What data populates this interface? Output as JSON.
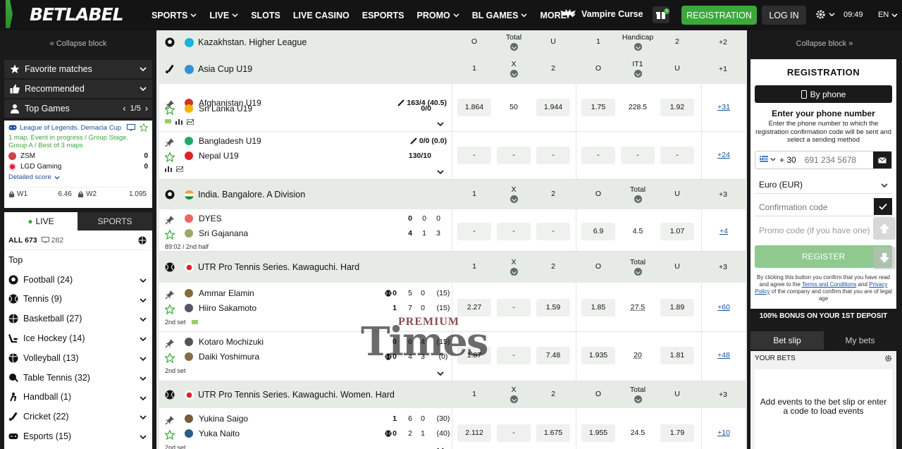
{
  "brand": {
    "logo_text": "BETLABEL"
  },
  "nav": {
    "items": [
      {
        "label": "SPORTS",
        "dropdown": true
      },
      {
        "label": "LIVE",
        "dropdown": true
      },
      {
        "label": "SLOTS",
        "dropdown": false
      },
      {
        "label": "LIVE CASINO",
        "dropdown": false
      },
      {
        "label": "ESPORTS",
        "dropdown": false
      },
      {
        "label": "PROMO",
        "dropdown": true
      },
      {
        "label": "BL GAMES",
        "dropdown": true
      },
      {
        "label": "MORE",
        "dropdown": true
      }
    ],
    "promo_label": "Vampire Curse",
    "gift_badge": "1",
    "register_label": "REGISTRATION",
    "login_label": "LOG IN",
    "time": "09:49",
    "lang": "EN"
  },
  "left": {
    "collapse_label": "Collapse block",
    "favorite_label": "Favorite matches",
    "recommended_label": "Recommended",
    "topgames_label": "Top Games",
    "topgames_pager": "1/5",
    "card": {
      "league": "League of Legends. Demacia Cup",
      "status": "1 map, Event in progress / Group Stage. Group A / Best of 3 maps",
      "team1": "ZSM",
      "score1": "0",
      "team2": "LGD Gaming",
      "score2": "0",
      "detailed": "Detailed score",
      "w1_label": "W1",
      "w1_odd": "6.46",
      "w2_label": "W2",
      "w2_odd": "1.095"
    },
    "tab_live": "LIVE",
    "tab_sports": "SPORTS",
    "all_label": "ALL 673",
    "all_screen_count": "282",
    "top_label": "Top",
    "sports": [
      {
        "label": "Football (24)",
        "icon": "football-icon"
      },
      {
        "label": "Tennis (9)",
        "icon": "tennis-icon"
      },
      {
        "label": "Basketball (27)",
        "icon": "basketball-icon"
      },
      {
        "label": "Ice Hockey (14)",
        "icon": "ice-hockey-icon"
      },
      {
        "label": "Volleyball (13)",
        "icon": "volleyball-icon"
      },
      {
        "label": "Table Tennis (32)",
        "icon": "table-tennis-icon"
      },
      {
        "label": "Handball (1)",
        "icon": "handball-icon"
      },
      {
        "label": "Cricket (22)",
        "icon": "cricket-icon"
      },
      {
        "label": "Esports (15)",
        "icon": "esports-icon"
      }
    ]
  },
  "main": {
    "leagues": [
      {
        "name": "Kazakhstan. Higher League",
        "cols": [
          "O",
          "Total",
          "U",
          "1",
          "Handicap",
          "2"
        ],
        "more": "+2"
      },
      {
        "name": "Asia Cup U19",
        "cols": [
          "1",
          "X",
          "2",
          "O",
          "IT1",
          "U"
        ],
        "more": "+1"
      },
      {
        "name": "India. Bangalore. A Division",
        "cols": [
          "1",
          "X",
          "2",
          "O",
          "Total",
          "U"
        ],
        "more": "+3"
      },
      {
        "name": "UTR Pro Tennis Series. Kawaguchi. Hard",
        "cols": [
          "1",
          "X",
          "2",
          "O",
          "Total",
          "U"
        ],
        "more": "+3"
      },
      {
        "name": "UTR Pro Tennis Series. Kawaguchi. Women. Hard",
        "cols": [
          "1",
          "X",
          "2",
          "O",
          "Total",
          "U"
        ],
        "more": "+3"
      }
    ],
    "matches": [
      {
        "team1": "Afghanistan U19",
        "team2": "Sri Lanka U19",
        "score1": "163/4 (40.5)",
        "score2": "0/0",
        "odds": [
          "1.864",
          "50",
          "1.944",
          "1.75",
          "228.5",
          "1.92"
        ],
        "more": "+31"
      },
      {
        "team1": "Bangladesh U19",
        "team2": "Nepal U19",
        "score1": "0/0 (0.0)",
        "score2": "130/10",
        "odds": [
          "-",
          "-",
          "-",
          "-",
          "-",
          "-"
        ],
        "more": "+24"
      },
      {
        "team1": "DYES",
        "team2": "Sri Gajanana",
        "s1": [
          "0",
          "0",
          "0"
        ],
        "s2": [
          "4",
          "1",
          "3"
        ],
        "time": "89:02 / 2nd half",
        "odds": [
          "-",
          "-",
          "-",
          "6.9",
          "4.5",
          "1.07"
        ],
        "more": "+4"
      },
      {
        "team1": "Ammar Elamin",
        "team2": "Hiiro Sakamoto",
        "s1": [
          "0",
          "5",
          "0",
          "(15)"
        ],
        "s2": [
          "1",
          "7",
          "0",
          "(15)"
        ],
        "time": "2nd set",
        "odds": [
          "2.27",
          "-",
          "1.59",
          "1.85",
          "27.5",
          "1.89"
        ],
        "more": "+60"
      },
      {
        "team1": "Kotaro Mochizuki",
        "team2": "Daiki Yoshimura",
        "s1": [
          "0",
          "6",
          "4",
          "(15)"
        ],
        "s2": [
          "0",
          "4",
          "3",
          "(0)"
        ],
        "time": "2nd set",
        "odds": [
          "1.87",
          "-",
          "7.48",
          "1.935",
          "20",
          "1.81"
        ],
        "more": "+48"
      },
      {
        "team1": "Yukina Saigo",
        "team2": "Yuka Naito",
        "s1": [
          "1",
          "6",
          "0",
          "(30)"
        ],
        "s2": [
          "0",
          "2",
          "1",
          "(40)"
        ],
        "time": "2nd set",
        "odds": [
          "2.112",
          "-",
          "1.675",
          "1.955",
          "24.5",
          "1.79"
        ],
        "more": "+10"
      }
    ],
    "watermark_top": "PREMIUM",
    "watermark_main": "Times"
  },
  "right": {
    "collapse_label": "Collapse block",
    "reg_title": "REGISTRATION",
    "by_phone": "By phone",
    "enter_heading": "Enter your phone number",
    "enter_text": "Enter the phone number to which the registration confirmation code will be sent and select a sending method",
    "phone_code": "+ 30",
    "phone_placeholder": "691 234 5678",
    "currency": "Euro (EUR)",
    "confirm_placeholder": "Confirmation code",
    "promo_placeholder": "Promo code (if you have one)",
    "register_btn": "REGISTER",
    "terms_a": "By clicking this button you confirm that you have read and agree to the",
    "terms_link1": "Terms and Conditions",
    "terms_b": "and",
    "terms_link2": "Privacy Policy",
    "terms_c": "of the company and confirm that you are of legal age",
    "bonus": "100% BONUS ON YOUR 1ST DEPOSIT",
    "tab_betslip": "Bet slip",
    "tab_mybets": "My bets",
    "your_bets": "YOUR BETS",
    "empty_msg": "Add events to the bet slip or enter a code to load events"
  },
  "colors": {
    "accent": "#3aa93a",
    "dark": "#141414",
    "link": "#1b4f9b"
  }
}
